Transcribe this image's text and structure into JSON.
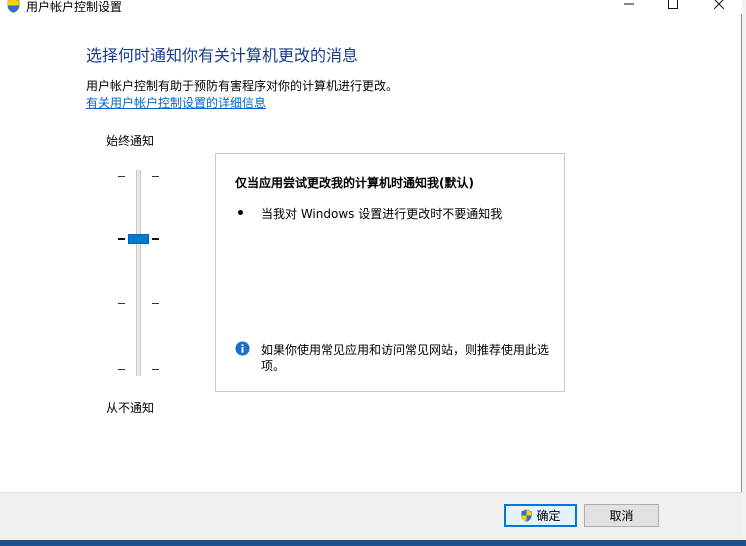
{
  "window": {
    "title": "用户帐户控制设置",
    "minimize_label": "最小化",
    "maximize_label": "最大化",
    "close_label": "关闭"
  },
  "header": {
    "heading": "选择何时通知你有关计算机更改的消息",
    "description": "用户帐户控制有助于预防有害程序对你的计算机进行更改。",
    "link": "有关用户帐户控制设置的详细信息"
  },
  "slider": {
    "top_label": "始终通知",
    "bottom_label": "从不通知",
    "levels": 4,
    "selected_level": 2
  },
  "panel": {
    "title": "仅当应用尝试更改我的计算机时通知我(默认)",
    "bullet": "当我对 Windows 设置进行更改时不要通知我",
    "info": "如果你使用常见应用和访问常见网站，则推荐使用此选项。"
  },
  "footer": {
    "ok_label": "确定",
    "cancel_label": "取消"
  },
  "colors": {
    "accent": "#0078d7",
    "heading": "#1b3c8a",
    "link": "#0066cc"
  }
}
